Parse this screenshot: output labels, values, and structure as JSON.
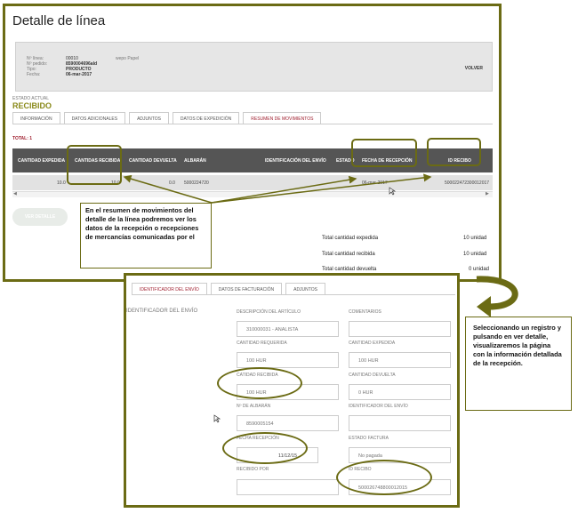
{
  "screen1": {
    "title": "Detalle de línea",
    "header": {
      "line_label": "Nº línea:",
      "line_value": "00010",
      "order_label": "Nº pedido:",
      "order_value": "8590004696ald",
      "type_label": "Tipo:",
      "type_value": "PRODUCTO",
      "date_label": "Fecha:",
      "date_value": "06-mar-2017",
      "item_desc": "wepo Papel",
      "back": "VOLVER"
    },
    "estado_label": "ESTADO ACTUAL",
    "estado_value": "RECIBIDO",
    "tabs": [
      "INFORMACIÓN",
      "DATOS ADICIONALES",
      "ADJUNTOS",
      "DATOS DE EXPEDICIÓN",
      "RESUMEN DE MOVIMIENTOS"
    ],
    "total_label": "TOTAL:",
    "total_value": "1",
    "columns": [
      "CANTIDAD EXPEDIDA",
      "CANTIDAS RECIBIDA",
      "CANTIDAD DEVUELTA",
      "ALBARÁN",
      "IDENTIFICACIÓN DEL ENVÍO",
      "ESTADO",
      "FECHA DE RECEPCIÓN",
      "ID RECIBO"
    ],
    "row": {
      "expedida": "10.0",
      "recibida": "10.0",
      "devuelta": "0.0",
      "albaran": "5000224720",
      "identificacion": "",
      "estado": "",
      "fecha": "06-mar-2017",
      "id_recibo": "500022472300012017"
    },
    "ver_detalle": "VER DETALLE",
    "totals": [
      {
        "label": "Total cantidad expedida",
        "value": "10 unidad"
      },
      {
        "label": "Total cantidad recibida",
        "value": "10 unidad"
      },
      {
        "label": "Total cantidad devuelta",
        "value": "0 unidad"
      }
    ]
  },
  "callout1": "En el resumen de movimientos del detalle de la línea podremos ver los datos de la recepción o recepciones de mercancías comunicadas por el",
  "callout2": "Seleccionando un registro y pulsando en ver detalle, visualizaremos la página con la información detallada de la recepción.",
  "screen2": {
    "tabs": [
      "IDENTIFICADOR DEL ENVÍO",
      "DATOS DE FACTURACIÓN",
      "ADJUNTOS"
    ],
    "section": "IDENTIFICADOR DEL ENVÍO",
    "fields": {
      "descripcion_label": "DESCRIPCIÓN DEL ARTÍCULO",
      "descripcion_value": "310000031 - ANALISTA",
      "comentarios_label": "COMENTARIOS",
      "comentarios_value": "",
      "requerida_label": "CANTIDAD REQUERIDA",
      "requerida_value": "100 HUR",
      "expedida_label": "CANTIDAD EXPEDIDA",
      "expedida_value": "100 HUR",
      "recibida_label": "CATIDAD RECIBIDA",
      "recibida_value": "100 HUR",
      "devuelta_label": "CANTIDAD DEVUELTA",
      "devuelta_value": "0 HUR",
      "albaran_label": "Nº DE ALBARÁN",
      "albaran_value": "8590005154",
      "ident_label": "IDENTIFICADOR DEL ENVÍO",
      "ident_value": "",
      "fecha_label": "FECHA RECEPCIÓN",
      "fecha_value": "11/12/15",
      "estado_fact_label": "ESTADO FACTURA",
      "estado_fact_value": "No pagada",
      "recibido_por_label": "RECIBIDO POR",
      "recibido_por_value": "",
      "id_recibo_label": "ID RECIBO",
      "id_recibo_value": "500026748800012015"
    }
  },
  "colors": {
    "frame": "#6b6b14",
    "accent_red": "#a02030",
    "status_green": "#8a8a1a",
    "table_header": "#555555"
  }
}
